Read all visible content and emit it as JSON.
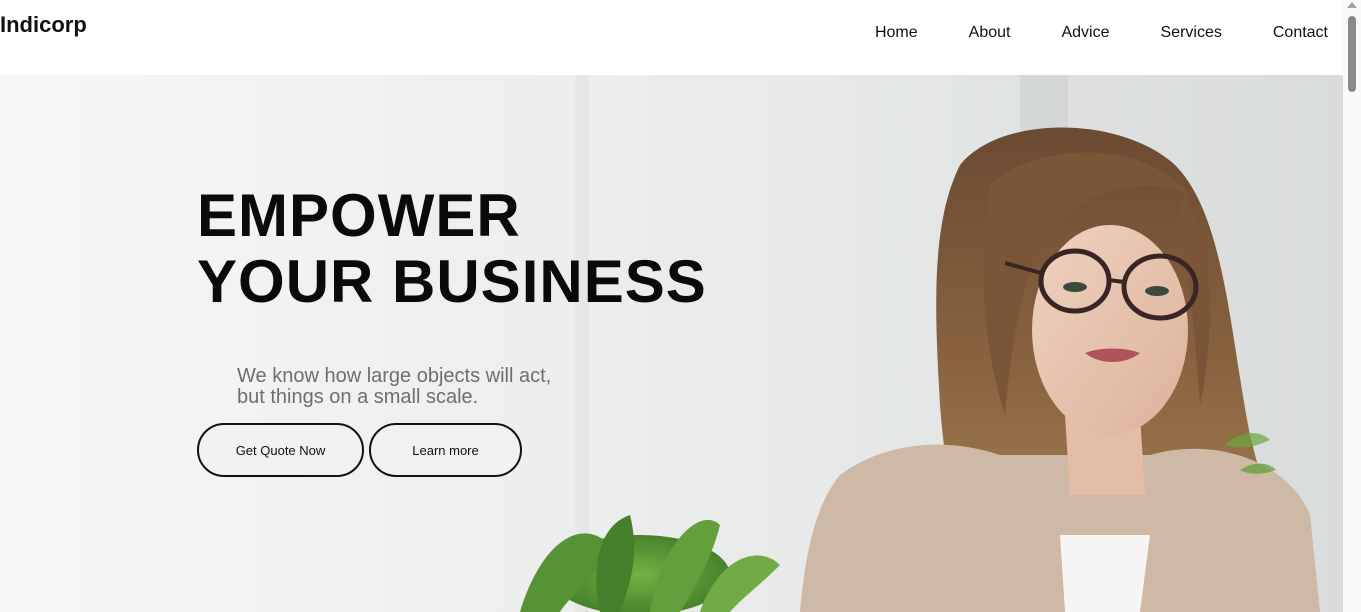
{
  "brand": {
    "name": "Indicorp"
  },
  "nav": {
    "items": [
      {
        "label": "Home"
      },
      {
        "label": "About"
      },
      {
        "label": "Advice"
      },
      {
        "label": "Services"
      },
      {
        "label": "Contact"
      }
    ]
  },
  "hero": {
    "title_line1": "EMPOWER",
    "title_line2": "YOUR BUSINESS",
    "subtitle_line1": "We know how large objects will act,",
    "subtitle_line2": "but things on a small scale.",
    "primary_button": "Get Quote Now",
    "secondary_button": "Learn more",
    "image_icon": "businesswoman-photo"
  },
  "colors": {
    "text": "#111111",
    "subtitle": "#6e6e6e",
    "button_bg": "#f1f1f1",
    "button_border": "#111111"
  }
}
